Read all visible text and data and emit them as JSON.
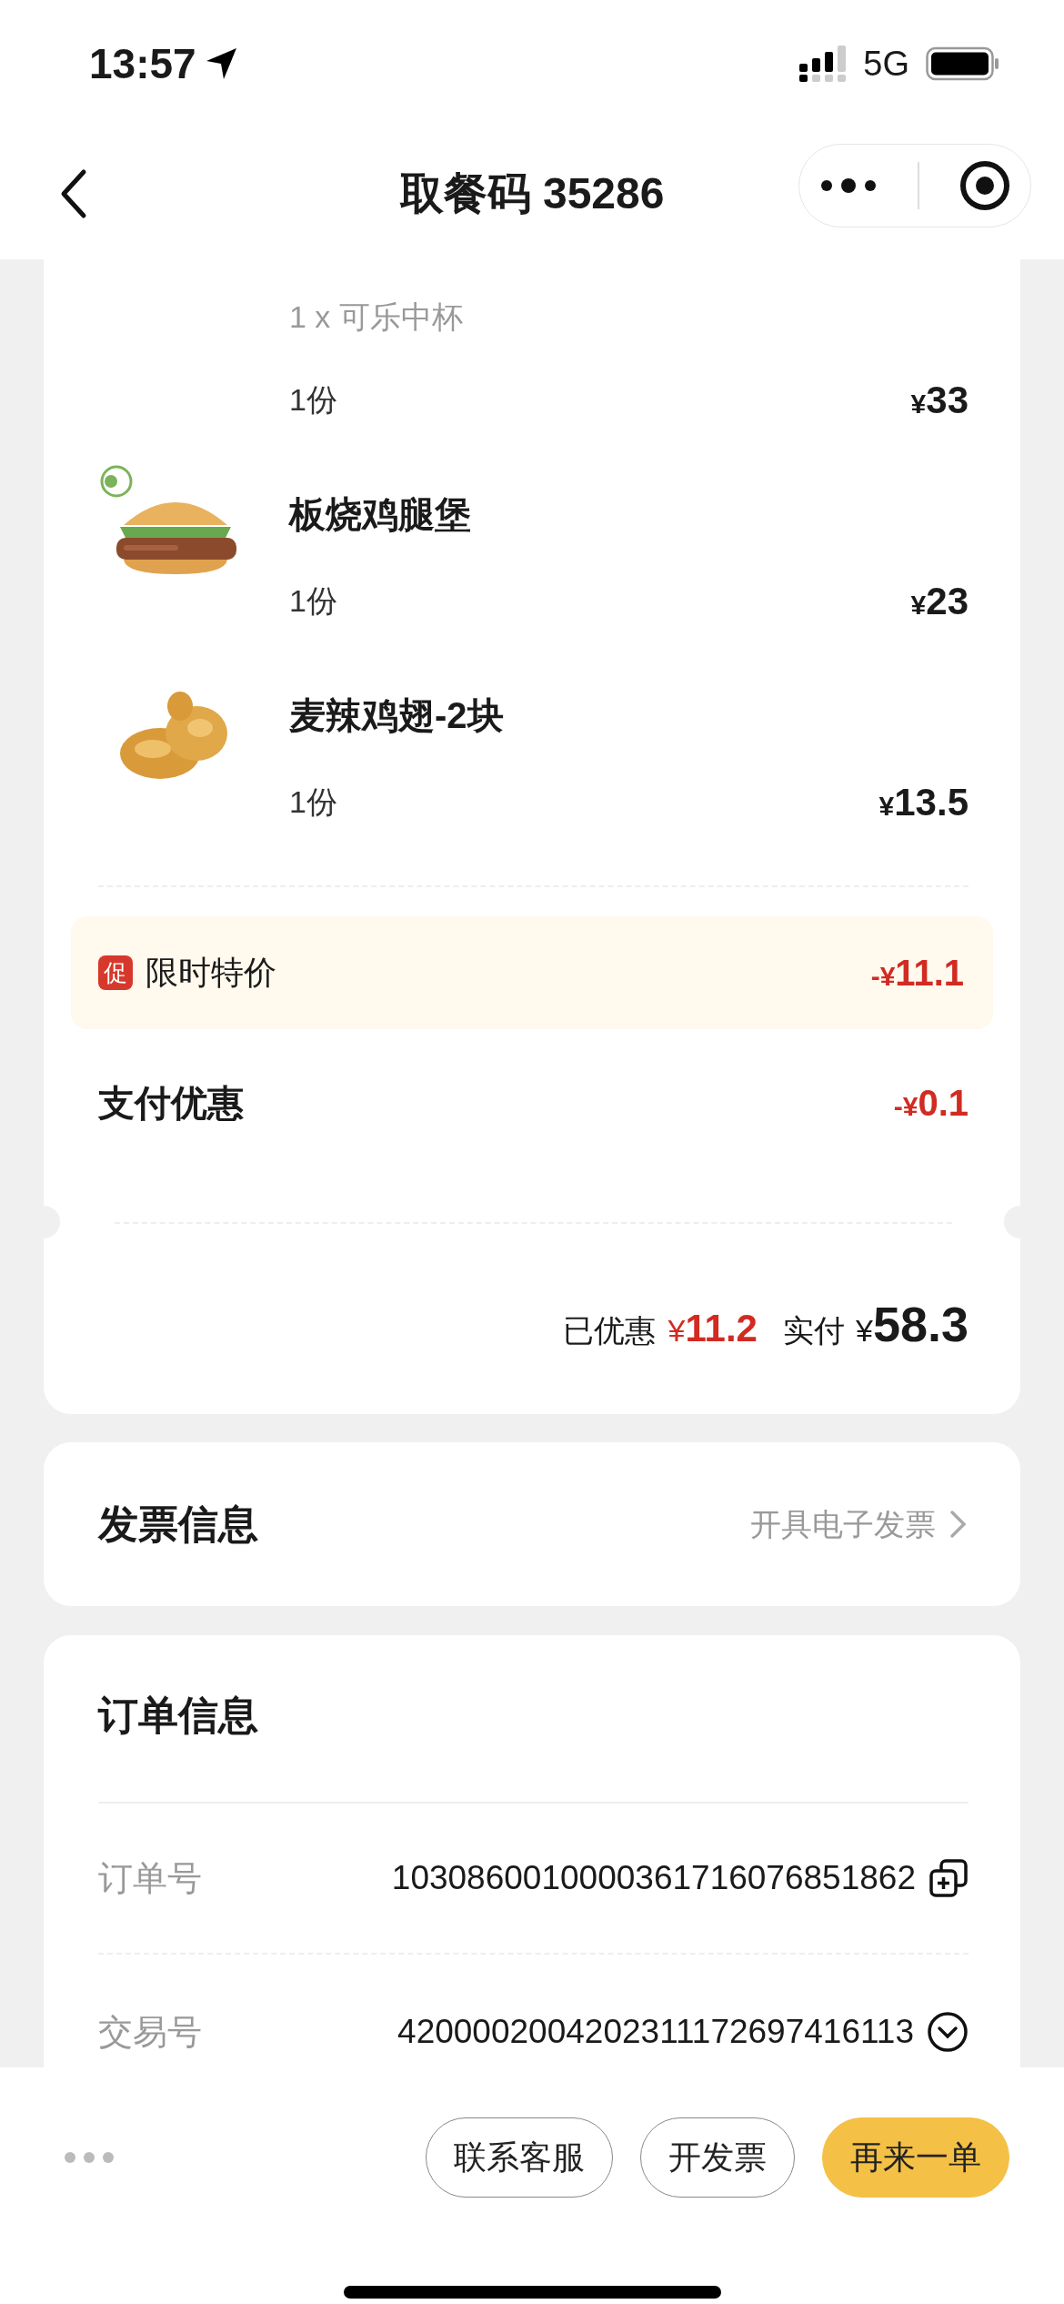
{
  "status_bar": {
    "time": "13:57",
    "network": "5G"
  },
  "header": {
    "title": "取餐码 35286"
  },
  "order_items": [
    {
      "kind": "combo",
      "sub_items": [
        "1 x 可乐中杯"
      ],
      "quantity": "1份",
      "currency": "¥",
      "price": "33"
    },
    {
      "kind": "burger",
      "name": "板烧鸡腿堡",
      "quantity": "1份",
      "currency": "¥",
      "price": "23"
    },
    {
      "kind": "wings",
      "name": "麦辣鸡翅-2块",
      "quantity": "1份",
      "currency": "¥",
      "price": "13.5"
    }
  ],
  "discounts": [
    {
      "kind": "promo",
      "badge": "促",
      "label": "限时特价",
      "sign": "-¥",
      "amount": "11.1"
    },
    {
      "kind": "plain",
      "label": "支付优惠",
      "sign": "-¥",
      "amount": "0.1"
    }
  ],
  "summary": {
    "saved_label": "已优惠",
    "saved_currency": "¥",
    "saved_amount": "11.2",
    "paid_label": "实付",
    "paid_currency": "¥",
    "paid_amount": "58.3"
  },
  "invoice": {
    "title": "发票信息",
    "action": "开具电子发票"
  },
  "order_info": {
    "title": "订单信息",
    "rows": [
      {
        "kind": "copy",
        "label": "订单号",
        "value": "1030860010000361716076851862"
      },
      {
        "kind": "expand",
        "label": "交易号",
        "value": "4200002004202311172697416113"
      }
    ]
  },
  "bottom_bar": {
    "buttons": [
      {
        "label": "联系客服",
        "primary": false
      },
      {
        "label": "开发票",
        "primary": false
      },
      {
        "label": "再来一单",
        "primary": true
      }
    ]
  }
}
